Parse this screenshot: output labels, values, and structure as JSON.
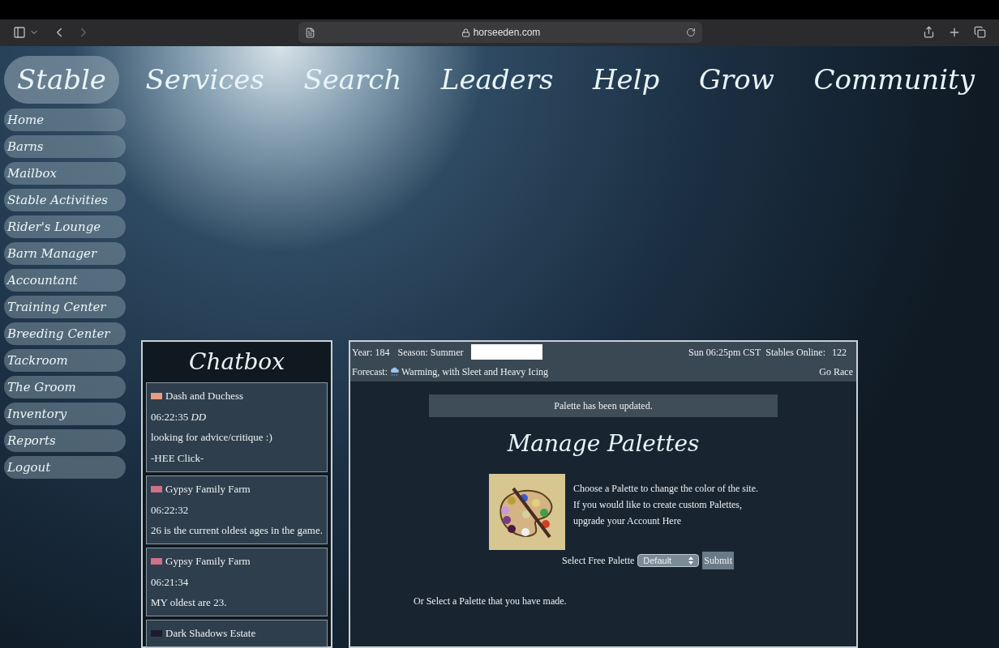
{
  "browser": {
    "url": "horseeden.com"
  },
  "top_nav": [
    {
      "label": "Stable",
      "selected": true
    },
    {
      "label": "Services",
      "selected": false
    },
    {
      "label": "Search",
      "selected": false
    },
    {
      "label": "Leaders",
      "selected": false
    },
    {
      "label": "Help",
      "selected": false
    },
    {
      "label": "Grow",
      "selected": false
    },
    {
      "label": "Community",
      "selected": false
    }
  ],
  "sidebar": {
    "items": [
      "Home",
      "Barns",
      "Mailbox",
      "Stable Activities",
      "Rider's Lounge",
      "Barn Manager",
      "Accountant",
      "Training Center",
      "Breeding Center",
      "Tackroom",
      "The Groom",
      "Inventory",
      "Reports",
      "Logout"
    ]
  },
  "chatbox": {
    "title": "Chatbox",
    "messages": [
      {
        "author": "Dash and Duchess",
        "color": "#e89c80",
        "time": "06:22:35 *DD*",
        "lines": [
          "looking for advice/critique :)",
          "-HEE Click-"
        ]
      },
      {
        "author": "Gypsy Family Farm",
        "color": "#d0708a",
        "time": "06:22:32",
        "lines": [
          "26 is the current oldest ages in the game."
        ]
      },
      {
        "author": "Gypsy Family Farm",
        "color": "#d0708a",
        "time": "06:21:34",
        "lines": [
          "MY oldest are 23."
        ]
      },
      {
        "author": "Dark Shadows Estate",
        "color": "#1c1c2c"
      }
    ]
  },
  "info_bar": {
    "year": "Year: 184",
    "season": "Season: Summer",
    "time": "Sun 06:25pm CST",
    "stables_online_label": "Stables Online:",
    "stables_online": "122",
    "forecast_label": "Forecast:",
    "forecast": "Warming, with Sleet and Heavy Icing",
    "go_race": "Go Race"
  },
  "main": {
    "notice": "Palette has been updated.",
    "title": "Manage Palettes",
    "description_lines": [
      "Choose a Palette to change the color of the site.",
      "If you would like to create custom Palettes,",
      "upgrade your Account Here"
    ],
    "select_label": "Select Free Palette",
    "select_value": "Default",
    "submit": "Submit",
    "custom_text": "Or Select a Palette that you have made."
  }
}
